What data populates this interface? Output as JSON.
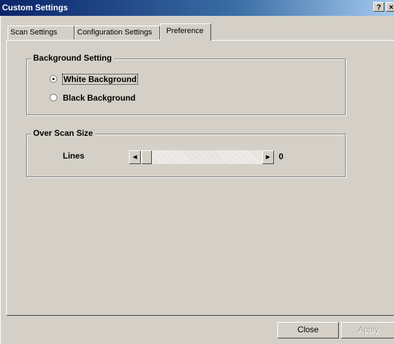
{
  "window": {
    "title": "Custom Settings",
    "help_button": "?",
    "close_button": "×"
  },
  "tabs": [
    {
      "label": "Scan Settings",
      "active": false
    },
    {
      "label": "Configuration Settings",
      "active": false
    },
    {
      "label": "Preference",
      "active": true
    }
  ],
  "background_setting": {
    "legend": "Background Setting",
    "options": [
      {
        "label": "White Background",
        "selected": true
      },
      {
        "label": "Black Background",
        "selected": false
      }
    ]
  },
  "over_scan": {
    "legend": "Over Scan Size",
    "lines_label": "Lines",
    "value": "0",
    "left_arrow": "◀",
    "right_arrow": "▶"
  },
  "buttons": {
    "close": "Close",
    "apply": "Apply"
  }
}
